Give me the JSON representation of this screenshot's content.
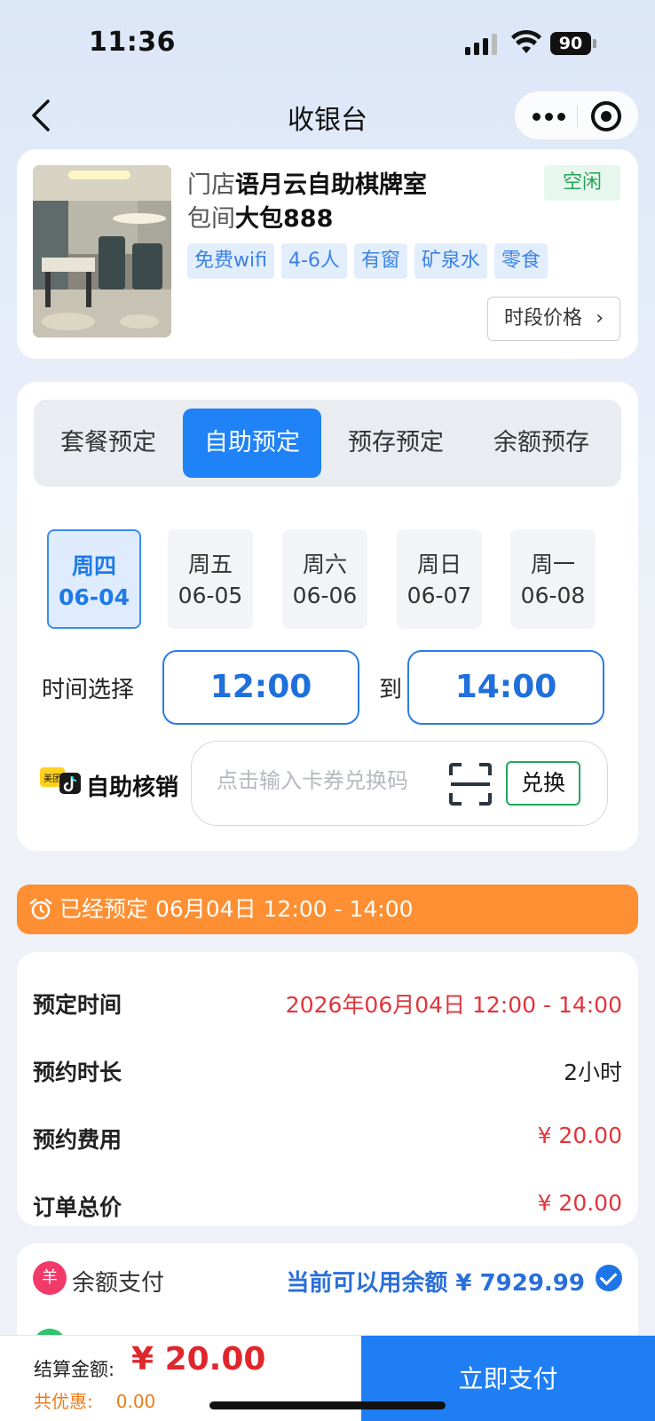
{
  "status_bar": {
    "time": "11:36",
    "battery": "90"
  },
  "nav": {
    "title": "收银台"
  },
  "room": {
    "store_prefix": "门店",
    "store_name": "语月云自助棋牌室",
    "room_prefix": "包间",
    "room_name": "大包888",
    "status": "空闲",
    "tags": [
      "免费wifi",
      "4-6人",
      "有窗",
      "矿泉水",
      "零食"
    ],
    "price_button": "时段价格"
  },
  "booking": {
    "tabs": [
      "套餐预定",
      "自助预定",
      "预存预定",
      "余额预存"
    ],
    "active_tab": 1,
    "days": [
      {
        "weekday": "周四",
        "date": "06-04"
      },
      {
        "weekday": "周五",
        "date": "06-05"
      },
      {
        "weekday": "周六",
        "date": "06-06"
      },
      {
        "weekday": "周日",
        "date": "06-07"
      },
      {
        "weekday": "周一",
        "date": "06-08"
      }
    ],
    "active_day": 0,
    "time_label": "时间选择",
    "start_time": "12:00",
    "to_label": "到",
    "end_time": "14:00",
    "verify_label": "自助核销",
    "verify_logo_text": "美团",
    "coupon_placeholder": "点击输入卡券兑换码",
    "redeem_button": "兑换"
  },
  "booked_banner": "已经预定 06月04日 12:00 - 14:00",
  "summary": [
    {
      "label": "预定时间",
      "value": "2026年06月04日 12:00 - 14:00",
      "highlight": true
    },
    {
      "label": "预约时长",
      "value": "2小时",
      "highlight": false
    },
    {
      "label": "预约费用",
      "value": "¥ 20.00",
      "highlight": true
    },
    {
      "label": "订单总价",
      "value": "¥ 20.00",
      "highlight": true
    }
  ],
  "payment": {
    "method_label": "余额支付",
    "coin_icon_text": "羊",
    "balance_text": "当前可以用余额 ¥ 7929.99",
    "selected": true
  },
  "bottom_bar": {
    "total_label": "结算金额:",
    "total_amount": "¥ 20.00",
    "discount_label": "共优惠:",
    "discount_value": "0.00",
    "pay_button": "立即支付"
  },
  "colors": {
    "accent": "#1f82f6",
    "price_red": "#e0353b",
    "banner_orange": "#fe8f32",
    "status_green": "#27a35a"
  }
}
